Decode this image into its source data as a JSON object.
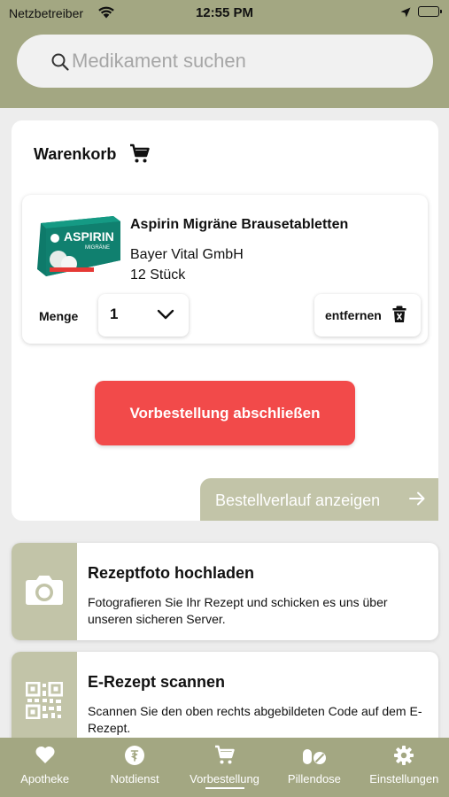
{
  "status_bar": {
    "carrier": "Netzbetreiber",
    "time": "12:55 PM"
  },
  "search": {
    "placeholder": "Medikament suchen"
  },
  "cart": {
    "title": "Warenkorb",
    "item": {
      "image_brand": "ASPIRIN",
      "image_sub": "MIGRÄNE",
      "name": "Aspirin Migräne Brausetabletten",
      "vendor": "Bayer Vital GmbH",
      "quantity_text": "12 Stück",
      "menge_label": "Menge",
      "menge_value": "1",
      "remove_label": "entfernen"
    },
    "submit_label": "Vorbestellung abschließen",
    "history_label": "Bestellverlauf anzeigen"
  },
  "features": [
    {
      "title": "Rezeptfoto hochladen",
      "description": "Fotografieren Sie Ihr Rezept und schicken es uns über unseren sicheren Server.",
      "icon": "camera-icon"
    },
    {
      "title": "E-Rezept scannen",
      "description": "Scannen Sie den oben rechts abgebildeten Code auf dem E-Rezept.",
      "icon": "qr-code-icon"
    }
  ],
  "tabs": [
    {
      "label": "Apotheke",
      "icon": "heart-icon",
      "active": false
    },
    {
      "label": "Notdienst",
      "icon": "emergency-icon",
      "active": false
    },
    {
      "label": "Vorbestellung",
      "icon": "cart-icon",
      "active": true
    },
    {
      "label": "Pillendose",
      "icon": "pills-icon",
      "active": false
    },
    {
      "label": "Einstellungen",
      "icon": "gear-icon",
      "active": false
    }
  ],
  "colors": {
    "header_bg": "#a3a782",
    "accent_light": "#c2c4a8",
    "submit_red": "#f24a4a",
    "page_bg": "#ededed"
  }
}
